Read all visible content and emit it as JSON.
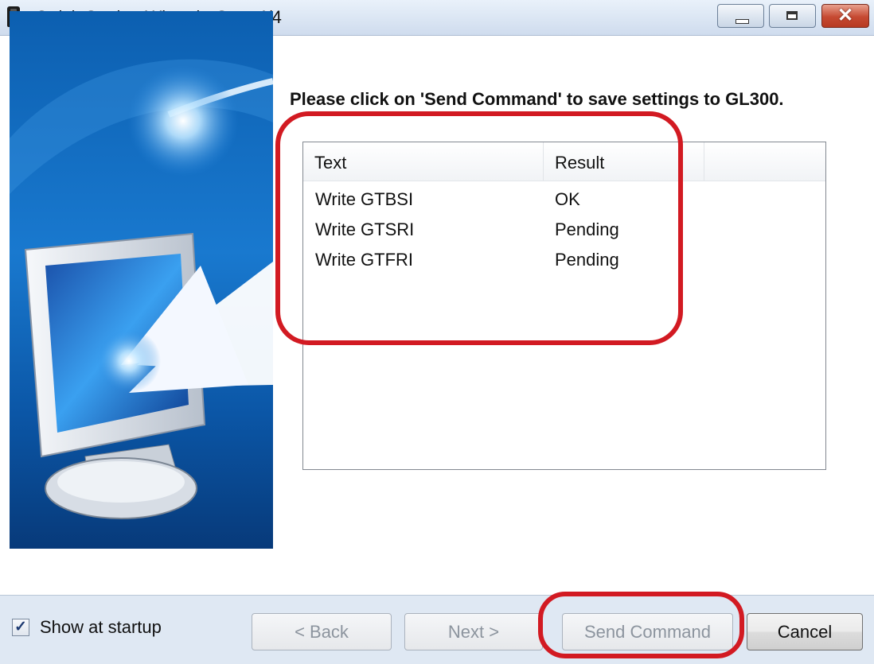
{
  "window": {
    "title": "Quick Setting Wizard - Step 4/4",
    "minimize_symbol": "▁",
    "maximize_symbol": "□",
    "close_symbol": "✕"
  },
  "main": {
    "instruction": "Please click on 'Send Command' to save settings to GL300.",
    "list": {
      "columns": [
        "Text",
        "Result",
        ""
      ],
      "rows": [
        {
          "text": "Write GTBSI",
          "result": "OK"
        },
        {
          "text": "Write GTSRI",
          "result": "Pending"
        },
        {
          "text": "Write GTFRI",
          "result": "Pending"
        }
      ]
    }
  },
  "footer": {
    "show_at_startup_label": "Show at startup",
    "show_at_startup_checked": true,
    "back_label": "< Back",
    "next_label": "Next >",
    "send_command_label": "Send Command",
    "cancel_label": "Cancel"
  },
  "icons": [
    "app-icon",
    "minimize-icon",
    "maximize-icon",
    "close-icon",
    "computer-arrow-illustration",
    "checkmark-icon"
  ],
  "colors": {
    "highlight": "#d21a22",
    "titlebar": "#dce6f3",
    "side_panel_blue": "#0a4f9c"
  }
}
